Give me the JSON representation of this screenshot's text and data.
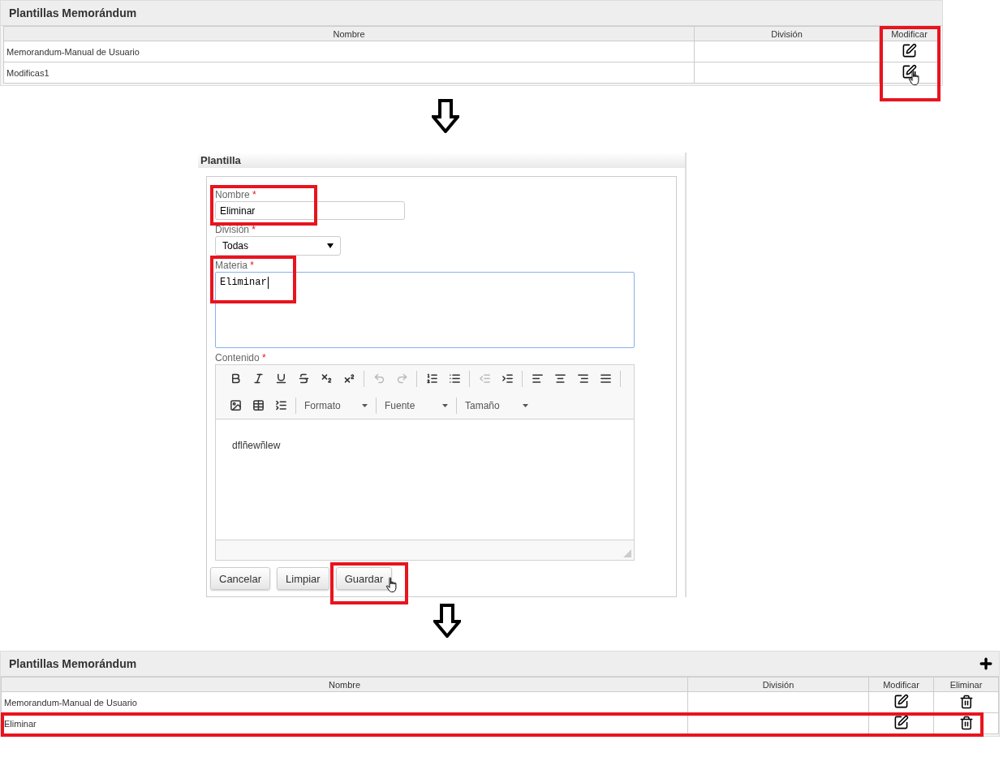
{
  "list_before": {
    "title": "Plantillas Memorándum",
    "columns": [
      {
        "label": "Nombre",
        "highlighted": false
      },
      {
        "label": "División",
        "highlighted": false
      },
      {
        "label": "Modificar",
        "highlighted": true
      }
    ],
    "rows": [
      {
        "name": "Memorandum-Manual de Usuario",
        "hovered": false,
        "highlighted": false
      },
      {
        "name": "Modificas1",
        "hovered": true,
        "highlighted": false
      }
    ]
  },
  "form": {
    "title": "Plantilla",
    "fields": [
      {
        "kind": "text",
        "label": "Nombre",
        "required_mark": "*",
        "value": "Eliminar",
        "highlighted": true
      },
      {
        "kind": "select",
        "label": "División",
        "required_mark": "*",
        "value": "Todas",
        "highlighted": false
      },
      {
        "kind": "textarea",
        "label": "Materia",
        "required_mark": "*",
        "value": "Eliminar",
        "focused": true,
        "highlighted": true
      },
      {
        "kind": "editor",
        "label": "Contenido",
        "required_mark": "*",
        "value": "dflñewñlew",
        "highlighted": false
      }
    ],
    "toolbar": [
      {
        "disabled": false
      },
      {
        "disabled": false
      },
      {
        "disabled": false
      },
      {
        "disabled": false
      },
      {
        "disabled": false
      },
      {
        "disabled": false
      },
      {
        "disabled": true
      },
      {
        "disabled": true
      },
      {
        "disabled": false
      },
      {
        "disabled": false
      },
      {
        "disabled": true
      },
      {
        "disabled": false
      },
      {
        "disabled": false
      },
      {
        "disabled": false
      },
      {
        "disabled": false
      },
      {
        "disabled": false
      },
      {
        "disabled": false
      },
      {
        "disabled": false
      },
      {
        "disabled": false
      }
    ],
    "dropdowns": [
      "Formato",
      "Fuente",
      "Tamaño"
    ],
    "buttons": [
      {
        "label": "Cancelar",
        "hovered": false,
        "highlighted": false
      },
      {
        "label": "Limpiar",
        "hovered": false,
        "highlighted": false
      },
      {
        "label": "Guardar",
        "hovered": true,
        "highlighted": true
      }
    ]
  },
  "list_after": {
    "title": "Plantillas Memorándum",
    "columns": [
      {
        "label": "Nombre",
        "highlighted": false
      },
      {
        "label": "División",
        "highlighted": false
      },
      {
        "label": "Modificar",
        "highlighted": false
      },
      {
        "label": "Eliminar",
        "highlighted": false
      }
    ],
    "rows": [
      {
        "name": "Memorandum-Manual de Usuario",
        "hovered": false,
        "highlighted": false
      },
      {
        "name": "Eliminar",
        "hovered": false,
        "highlighted": true
      }
    ]
  }
}
